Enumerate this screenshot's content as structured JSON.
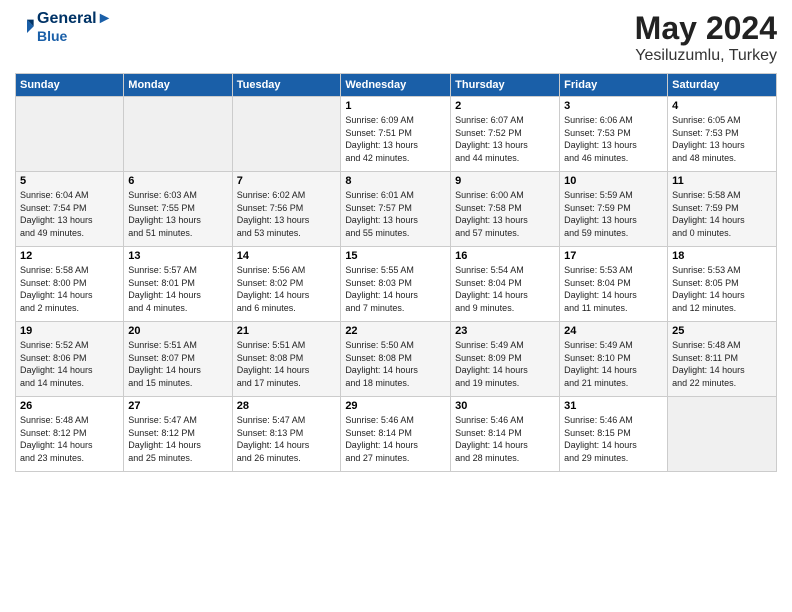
{
  "logo": {
    "line1": "General",
    "line2": "Blue"
  },
  "title": "May 2024",
  "location": "Yesiluzumlu, Turkey",
  "days_header": [
    "Sunday",
    "Monday",
    "Tuesday",
    "Wednesday",
    "Thursday",
    "Friday",
    "Saturday"
  ],
  "weeks": [
    [
      {
        "num": "",
        "info": ""
      },
      {
        "num": "",
        "info": ""
      },
      {
        "num": "",
        "info": ""
      },
      {
        "num": "1",
        "info": "Sunrise: 6:09 AM\nSunset: 7:51 PM\nDaylight: 13 hours\nand 42 minutes."
      },
      {
        "num": "2",
        "info": "Sunrise: 6:07 AM\nSunset: 7:52 PM\nDaylight: 13 hours\nand 44 minutes."
      },
      {
        "num": "3",
        "info": "Sunrise: 6:06 AM\nSunset: 7:53 PM\nDaylight: 13 hours\nand 46 minutes."
      },
      {
        "num": "4",
        "info": "Sunrise: 6:05 AM\nSunset: 7:53 PM\nDaylight: 13 hours\nand 48 minutes."
      }
    ],
    [
      {
        "num": "5",
        "info": "Sunrise: 6:04 AM\nSunset: 7:54 PM\nDaylight: 13 hours\nand 49 minutes."
      },
      {
        "num": "6",
        "info": "Sunrise: 6:03 AM\nSunset: 7:55 PM\nDaylight: 13 hours\nand 51 minutes."
      },
      {
        "num": "7",
        "info": "Sunrise: 6:02 AM\nSunset: 7:56 PM\nDaylight: 13 hours\nand 53 minutes."
      },
      {
        "num": "8",
        "info": "Sunrise: 6:01 AM\nSunset: 7:57 PM\nDaylight: 13 hours\nand 55 minutes."
      },
      {
        "num": "9",
        "info": "Sunrise: 6:00 AM\nSunset: 7:58 PM\nDaylight: 13 hours\nand 57 minutes."
      },
      {
        "num": "10",
        "info": "Sunrise: 5:59 AM\nSunset: 7:59 PM\nDaylight: 13 hours\nand 59 minutes."
      },
      {
        "num": "11",
        "info": "Sunrise: 5:58 AM\nSunset: 7:59 PM\nDaylight: 14 hours\nand 0 minutes."
      }
    ],
    [
      {
        "num": "12",
        "info": "Sunrise: 5:58 AM\nSunset: 8:00 PM\nDaylight: 14 hours\nand 2 minutes."
      },
      {
        "num": "13",
        "info": "Sunrise: 5:57 AM\nSunset: 8:01 PM\nDaylight: 14 hours\nand 4 minutes."
      },
      {
        "num": "14",
        "info": "Sunrise: 5:56 AM\nSunset: 8:02 PM\nDaylight: 14 hours\nand 6 minutes."
      },
      {
        "num": "15",
        "info": "Sunrise: 5:55 AM\nSunset: 8:03 PM\nDaylight: 14 hours\nand 7 minutes."
      },
      {
        "num": "16",
        "info": "Sunrise: 5:54 AM\nSunset: 8:04 PM\nDaylight: 14 hours\nand 9 minutes."
      },
      {
        "num": "17",
        "info": "Sunrise: 5:53 AM\nSunset: 8:04 PM\nDaylight: 14 hours\nand 11 minutes."
      },
      {
        "num": "18",
        "info": "Sunrise: 5:53 AM\nSunset: 8:05 PM\nDaylight: 14 hours\nand 12 minutes."
      }
    ],
    [
      {
        "num": "19",
        "info": "Sunrise: 5:52 AM\nSunset: 8:06 PM\nDaylight: 14 hours\nand 14 minutes."
      },
      {
        "num": "20",
        "info": "Sunrise: 5:51 AM\nSunset: 8:07 PM\nDaylight: 14 hours\nand 15 minutes."
      },
      {
        "num": "21",
        "info": "Sunrise: 5:51 AM\nSunset: 8:08 PM\nDaylight: 14 hours\nand 17 minutes."
      },
      {
        "num": "22",
        "info": "Sunrise: 5:50 AM\nSunset: 8:08 PM\nDaylight: 14 hours\nand 18 minutes."
      },
      {
        "num": "23",
        "info": "Sunrise: 5:49 AM\nSunset: 8:09 PM\nDaylight: 14 hours\nand 19 minutes."
      },
      {
        "num": "24",
        "info": "Sunrise: 5:49 AM\nSunset: 8:10 PM\nDaylight: 14 hours\nand 21 minutes."
      },
      {
        "num": "25",
        "info": "Sunrise: 5:48 AM\nSunset: 8:11 PM\nDaylight: 14 hours\nand 22 minutes."
      }
    ],
    [
      {
        "num": "26",
        "info": "Sunrise: 5:48 AM\nSunset: 8:12 PM\nDaylight: 14 hours\nand 23 minutes."
      },
      {
        "num": "27",
        "info": "Sunrise: 5:47 AM\nSunset: 8:12 PM\nDaylight: 14 hours\nand 25 minutes."
      },
      {
        "num": "28",
        "info": "Sunrise: 5:47 AM\nSunset: 8:13 PM\nDaylight: 14 hours\nand 26 minutes."
      },
      {
        "num": "29",
        "info": "Sunrise: 5:46 AM\nSunset: 8:14 PM\nDaylight: 14 hours\nand 27 minutes."
      },
      {
        "num": "30",
        "info": "Sunrise: 5:46 AM\nSunset: 8:14 PM\nDaylight: 14 hours\nand 28 minutes."
      },
      {
        "num": "31",
        "info": "Sunrise: 5:46 AM\nSunset: 8:15 PM\nDaylight: 14 hours\nand 29 minutes."
      },
      {
        "num": "",
        "info": ""
      }
    ]
  ]
}
